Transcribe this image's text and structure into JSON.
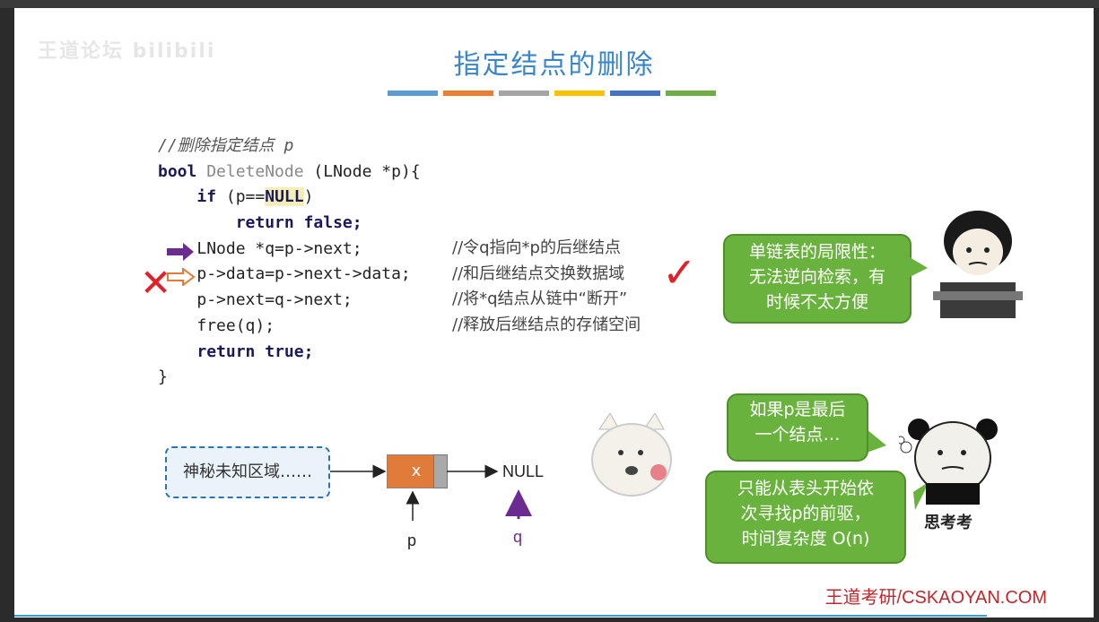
{
  "watermark": "王道论坛 bilibili",
  "title": "指定结点的删除",
  "stripe_colors": [
    "#5b9bd5",
    "#ed7d31",
    "#a5a5a5",
    "#ffc000",
    "#4472c4",
    "#70ad47"
  ],
  "code": {
    "comment_header": "//删除指定结点 p",
    "sig_bool": "bool",
    "sig_name": "DeleteNode",
    "sig_params": " (LNode *p){",
    "if_kw": "if",
    "if_open": " (p==",
    "if_null": "NULL",
    "if_close": ")",
    "ret_false_kw": "return",
    "ret_false_val": "false;",
    "line_q": "LNode *q=p->next;",
    "line_data": "p->data=p->next->data;",
    "line_next": "p->next=q->next;",
    "line_free": "free(q);",
    "ret_true_kw": "return",
    "ret_true_val": "true;",
    "close_brace": "}"
  },
  "comments": {
    "c1": "//令q指向*p的后继结点",
    "c2": "//和后继结点交换数据域",
    "c3": "//将*q结点从链中“断开”",
    "c4": "//释放后继结点的存储空间"
  },
  "bubbles": {
    "limit_l1": "单链表的局限性：",
    "limit_l2": "无法逆向检索，有",
    "limit_l3": "时候不太方便",
    "last_l1": "如果p是最后",
    "last_l2": "一个结点…",
    "only_l1": "只能从表头开始依",
    "only_l2": "次寻找p的前驱，",
    "only_l3": "时间复杂度 O(n)"
  },
  "diagram": {
    "unknown_region": "神秘未知区域……",
    "node_value": "x",
    "null_label": "NULL",
    "p_label": "p",
    "q_label": "q"
  },
  "sticker_caption": "思考考",
  "footer": "王道考研/CSKAOYAN.COM",
  "colors": {
    "title": "#3b86c8",
    "bubble": "#6ab23e",
    "accent_red": "#e0202a",
    "purple": "#6a2c91",
    "orange": "#e07b39"
  }
}
